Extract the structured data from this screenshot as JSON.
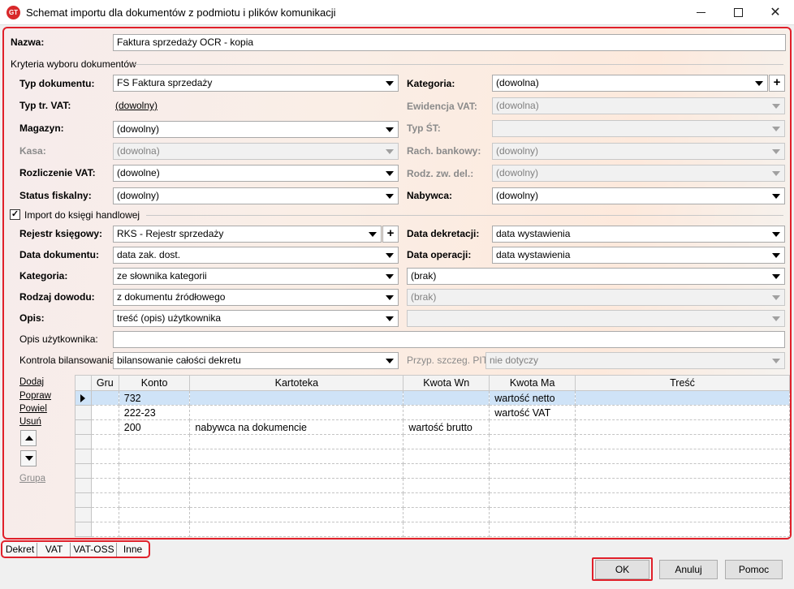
{
  "window": {
    "title": "Schemat importu dla dokumentów z podmiotu i plików komunikacji",
    "app_icon_text": "GT"
  },
  "form": {
    "nazwa_label": "Nazwa:",
    "nazwa_value": "Faktura sprzedaży OCR - kopia",
    "section_kryteria": "Kryteria wyboru dokumentów",
    "typ_dokumentu_label": "Typ dokumentu:",
    "typ_dokumentu_value": "FS Faktura sprzedaży",
    "kategoria_label": "Kategoria:",
    "kategoria_value": "(dowolna)",
    "typ_vat_label": "Typ tr. VAT:",
    "typ_vat_value": "(dowolny)",
    "ewidencja_label": "Ewidencja VAT:",
    "ewidencja_value": "(dowolna)",
    "magazyn_label": "Magazyn:",
    "magazyn_value": "(dowolny)",
    "typ_st_label": "Typ ŚT:",
    "typ_st_value": "",
    "kasa_label": "Kasa:",
    "kasa_value": "(dowolna)",
    "rach_label": "Rach. bankowy:",
    "rach_value": "(dowolny)",
    "rozliczenie_label": "Rozliczenie VAT:",
    "rozliczenie_value": "(dowolne)",
    "rodz_label": "Rodz. zw. del.:",
    "rodz_value": "(dowolny)",
    "status_label": "Status fiskalny:",
    "status_value": "(dowolny)",
    "nabywca_label": "Nabywca:",
    "nabywca_value": "(dowolny)",
    "import_checkbox_label": "Import do księgi handlowej",
    "import_checked": true,
    "rejestr_label": "Rejestr księgowy:",
    "rejestr_value": "RKS - Rejestr sprzedaży",
    "data_dekretacji_label": "Data dekretacji:",
    "data_dekretacji_value": "data wystawienia",
    "data_dokumentu_label": "Data dokumentu:",
    "data_dokumentu_value": "data zak. dost.",
    "data_operacji_label": "Data operacji:",
    "data_operacji_value": "data wystawienia",
    "kategoria2_label": "Kategoria:",
    "kategoria2_value": "ze słownika kategorii",
    "kategoria2_right_value": "(brak)",
    "rodzaj_label": "Rodzaj dowodu:",
    "rodzaj_value": "z dokumentu źródłowego",
    "rodzaj_right_value": "(brak)",
    "opis_label": "Opis:",
    "opis_value": "treść (opis) użytkownika",
    "opis_right_value": "",
    "opis_uzytkownika_label": "Opis użytkownika:",
    "opis_uzytkownika_value": "",
    "kontrola_label": "Kontrola bilansowania:",
    "kontrola_value": "bilansowanie całości dekretu",
    "przyp_label": "Przyp. szczeg. PIT:",
    "przyp_value": "nie dotyczy"
  },
  "grid": {
    "side_links": {
      "dodaj": "Dodaj",
      "popraw": "Popraw",
      "powiel": "Powiel",
      "usun": "Usuń",
      "grupa": "Grupa"
    },
    "columns": [
      "Gru",
      "Konto",
      "Kartoteka",
      "Kwota Wn",
      "Kwota Ma",
      "Treść"
    ],
    "rows": [
      {
        "gru": "",
        "konto": "732",
        "kartoteka": "",
        "kwota_wn": "",
        "kwota_ma": "wartość netto",
        "tresc": ""
      },
      {
        "gru": "",
        "konto": "222-23",
        "kartoteka": "",
        "kwota_wn": "",
        "kwota_ma": "wartość VAT",
        "tresc": ""
      },
      {
        "gru": "",
        "konto": "200",
        "kartoteka": "nabywca na dokumencie",
        "kwota_wn": "wartość brutto",
        "kwota_ma": "",
        "tresc": ""
      },
      {
        "gru": "",
        "konto": "",
        "kartoteka": "",
        "kwota_wn": "",
        "kwota_ma": "",
        "tresc": ""
      },
      {
        "gru": "",
        "konto": "",
        "kartoteka": "",
        "kwota_wn": "",
        "kwota_ma": "",
        "tresc": ""
      },
      {
        "gru": "",
        "konto": "",
        "kartoteka": "",
        "kwota_wn": "",
        "kwota_ma": "",
        "tresc": ""
      },
      {
        "gru": "",
        "konto": "",
        "kartoteka": "",
        "kwota_wn": "",
        "kwota_ma": "",
        "tresc": ""
      },
      {
        "gru": "",
        "konto": "",
        "kartoteka": "",
        "kwota_wn": "",
        "kwota_ma": "",
        "tresc": ""
      },
      {
        "gru": "",
        "konto": "",
        "kartoteka": "",
        "kwota_wn": "",
        "kwota_ma": "",
        "tresc": ""
      },
      {
        "gru": "",
        "konto": "",
        "kartoteka": "",
        "kwota_wn": "",
        "kwota_ma": "",
        "tresc": ""
      }
    ]
  },
  "tabs": [
    "Dekret",
    "VAT",
    "VAT-OSS",
    "Inne"
  ],
  "buttons": {
    "ok": "OK",
    "anuluj": "Anuluj",
    "pomoc": "Pomoc"
  },
  "colors": {
    "highlight": "#e0202a",
    "selected_row": "#cfe3f7"
  }
}
